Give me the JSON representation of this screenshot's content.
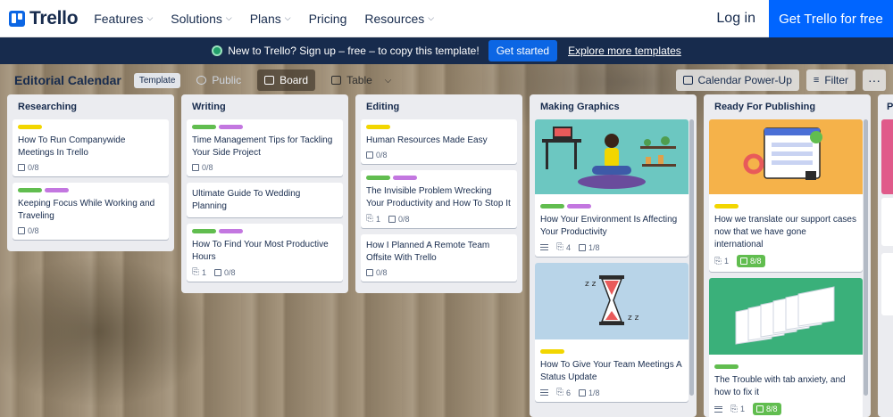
{
  "nav": {
    "logo": "Trello",
    "items": [
      {
        "label": "Features",
        "chevron": "chevron-down-icon"
      },
      {
        "label": "Solutions",
        "chevron": "chevron-down-icon"
      },
      {
        "label": "Plans",
        "chevron": "chevron-down-icon"
      },
      {
        "label": "Pricing"
      },
      {
        "label": "Resources",
        "chevron": "chevron-down-icon"
      }
    ],
    "login": "Log in",
    "cta": "Get Trello for free",
    "cta_color": "#0065ff"
  },
  "banner": {
    "text": "New to Trello? Sign up – free – to copy this template!",
    "button": "Get started",
    "link": "Explore more templates",
    "bg_color": "#172b4d"
  },
  "board": {
    "title": "Editorial Calendar",
    "tag": "Template",
    "visibility": "Public",
    "view_board": "Board",
    "view_table": "Table",
    "powerup": "Calendar Power-Up",
    "filter": "Filter",
    "more": "···"
  },
  "labels": {
    "yellow": "#f2d600",
    "green": "#61bd4f",
    "purple": "#c377e0"
  },
  "lists": [
    {
      "title": "Researching",
      "cards": [
        {
          "labels": [
            "yellow"
          ],
          "title": "How To Run Companywide Meetings In Trello",
          "checklist": "0/8"
        },
        {
          "labels": [
            "green",
            "purple"
          ],
          "title": "Keeping Focus While Working and Traveling",
          "checklist": "0/8"
        }
      ]
    },
    {
      "title": "Writing",
      "cards": [
        {
          "labels": [
            "green",
            "purple"
          ],
          "title": "Time Management Tips for Tackling Your Side Project",
          "checklist": "0/8"
        },
        {
          "labels": [],
          "title": "Ultimate Guide To Wedding Planning"
        },
        {
          "labels": [
            "green",
            "purple"
          ],
          "title": "How To Find Your Most Productive Hours",
          "attachments": "1",
          "checklist": "0/8"
        }
      ]
    },
    {
      "title": "Editing",
      "cards": [
        {
          "labels": [
            "yellow"
          ],
          "title": "Human Resources Made Easy",
          "checklist": "0/8"
        },
        {
          "labels": [
            "green",
            "purple"
          ],
          "title": "The Invisible Problem Wrecking Your Productivity and How To Stop It",
          "attachments": "1",
          "checklist": "0/8"
        },
        {
          "labels": [],
          "title": "How I Planned A Remote Team Offsite With Trello",
          "checklist": "0/8"
        }
      ]
    },
    {
      "title": "Making Graphics",
      "cards": [
        {
          "cover": "meditation-illustration",
          "labels": [
            "green",
            "purple"
          ],
          "title": "How Your Environment Is Affecting Your Productivity",
          "description": true,
          "attachments": "4",
          "checklist": "1/8"
        },
        {
          "cover": "hourglass-illustration",
          "labels": [
            "yellow"
          ],
          "title": "How To Give Your Team Meetings A Status Update",
          "description": true,
          "attachments": "6",
          "checklist": "1/8"
        }
      ]
    },
    {
      "title": "Ready For Publishing",
      "cards": [
        {
          "cover": "support-browser-illustration",
          "labels": [
            "yellow"
          ],
          "title": "How we translate our support cases now that we have gone international",
          "attachments": "1",
          "checklist": "8/8",
          "checklist_done": true
        },
        {
          "cover": "tabs-illustration",
          "labels": [
            "green"
          ],
          "title": "The Trouble with tab anxiety, and how to fix it",
          "description": true,
          "attachments": "1",
          "checklist": "8/8",
          "checklist_done": true
        }
      ]
    },
    {
      "title": "P"
    }
  ]
}
